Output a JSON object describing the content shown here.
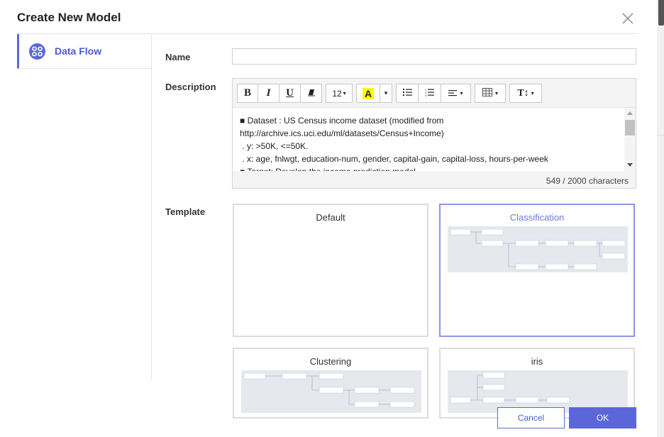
{
  "dialog": {
    "title": "Create New Model"
  },
  "sidebar": {
    "items": [
      {
        "label": "Data Flow",
        "icon": "data-flow-icon",
        "selected": true
      }
    ]
  },
  "form": {
    "name_label": "Name",
    "name_value": "",
    "description_label": "Description",
    "template_label": "Template"
  },
  "editor": {
    "font_size": "12",
    "lines": [
      "■ Dataset : US Census income dataset (modified from",
      "http://archive.ics.uci.edu/ml/datasets/Census+Income)",
      " . y: >50K, <=50K.",
      " . x: age, fnlwgt, education-num, gender, capital-gain, capital-loss, hours-per-week",
      "■ Target: Develop the income prediction model."
    ],
    "char_count": "549 / 2000 characters"
  },
  "templates": [
    {
      "name": "Default",
      "selected": false
    },
    {
      "name": "Classification",
      "selected": true
    },
    {
      "name": "Clustering",
      "selected": false
    },
    {
      "name": "iris",
      "selected": false
    }
  ],
  "footer": {
    "cancel_label": "Cancel",
    "ok_label": "OK"
  },
  "colors": {
    "accent": "#5b67d8",
    "selected_border": "#8f96e6",
    "highlight": "#ffff00"
  }
}
